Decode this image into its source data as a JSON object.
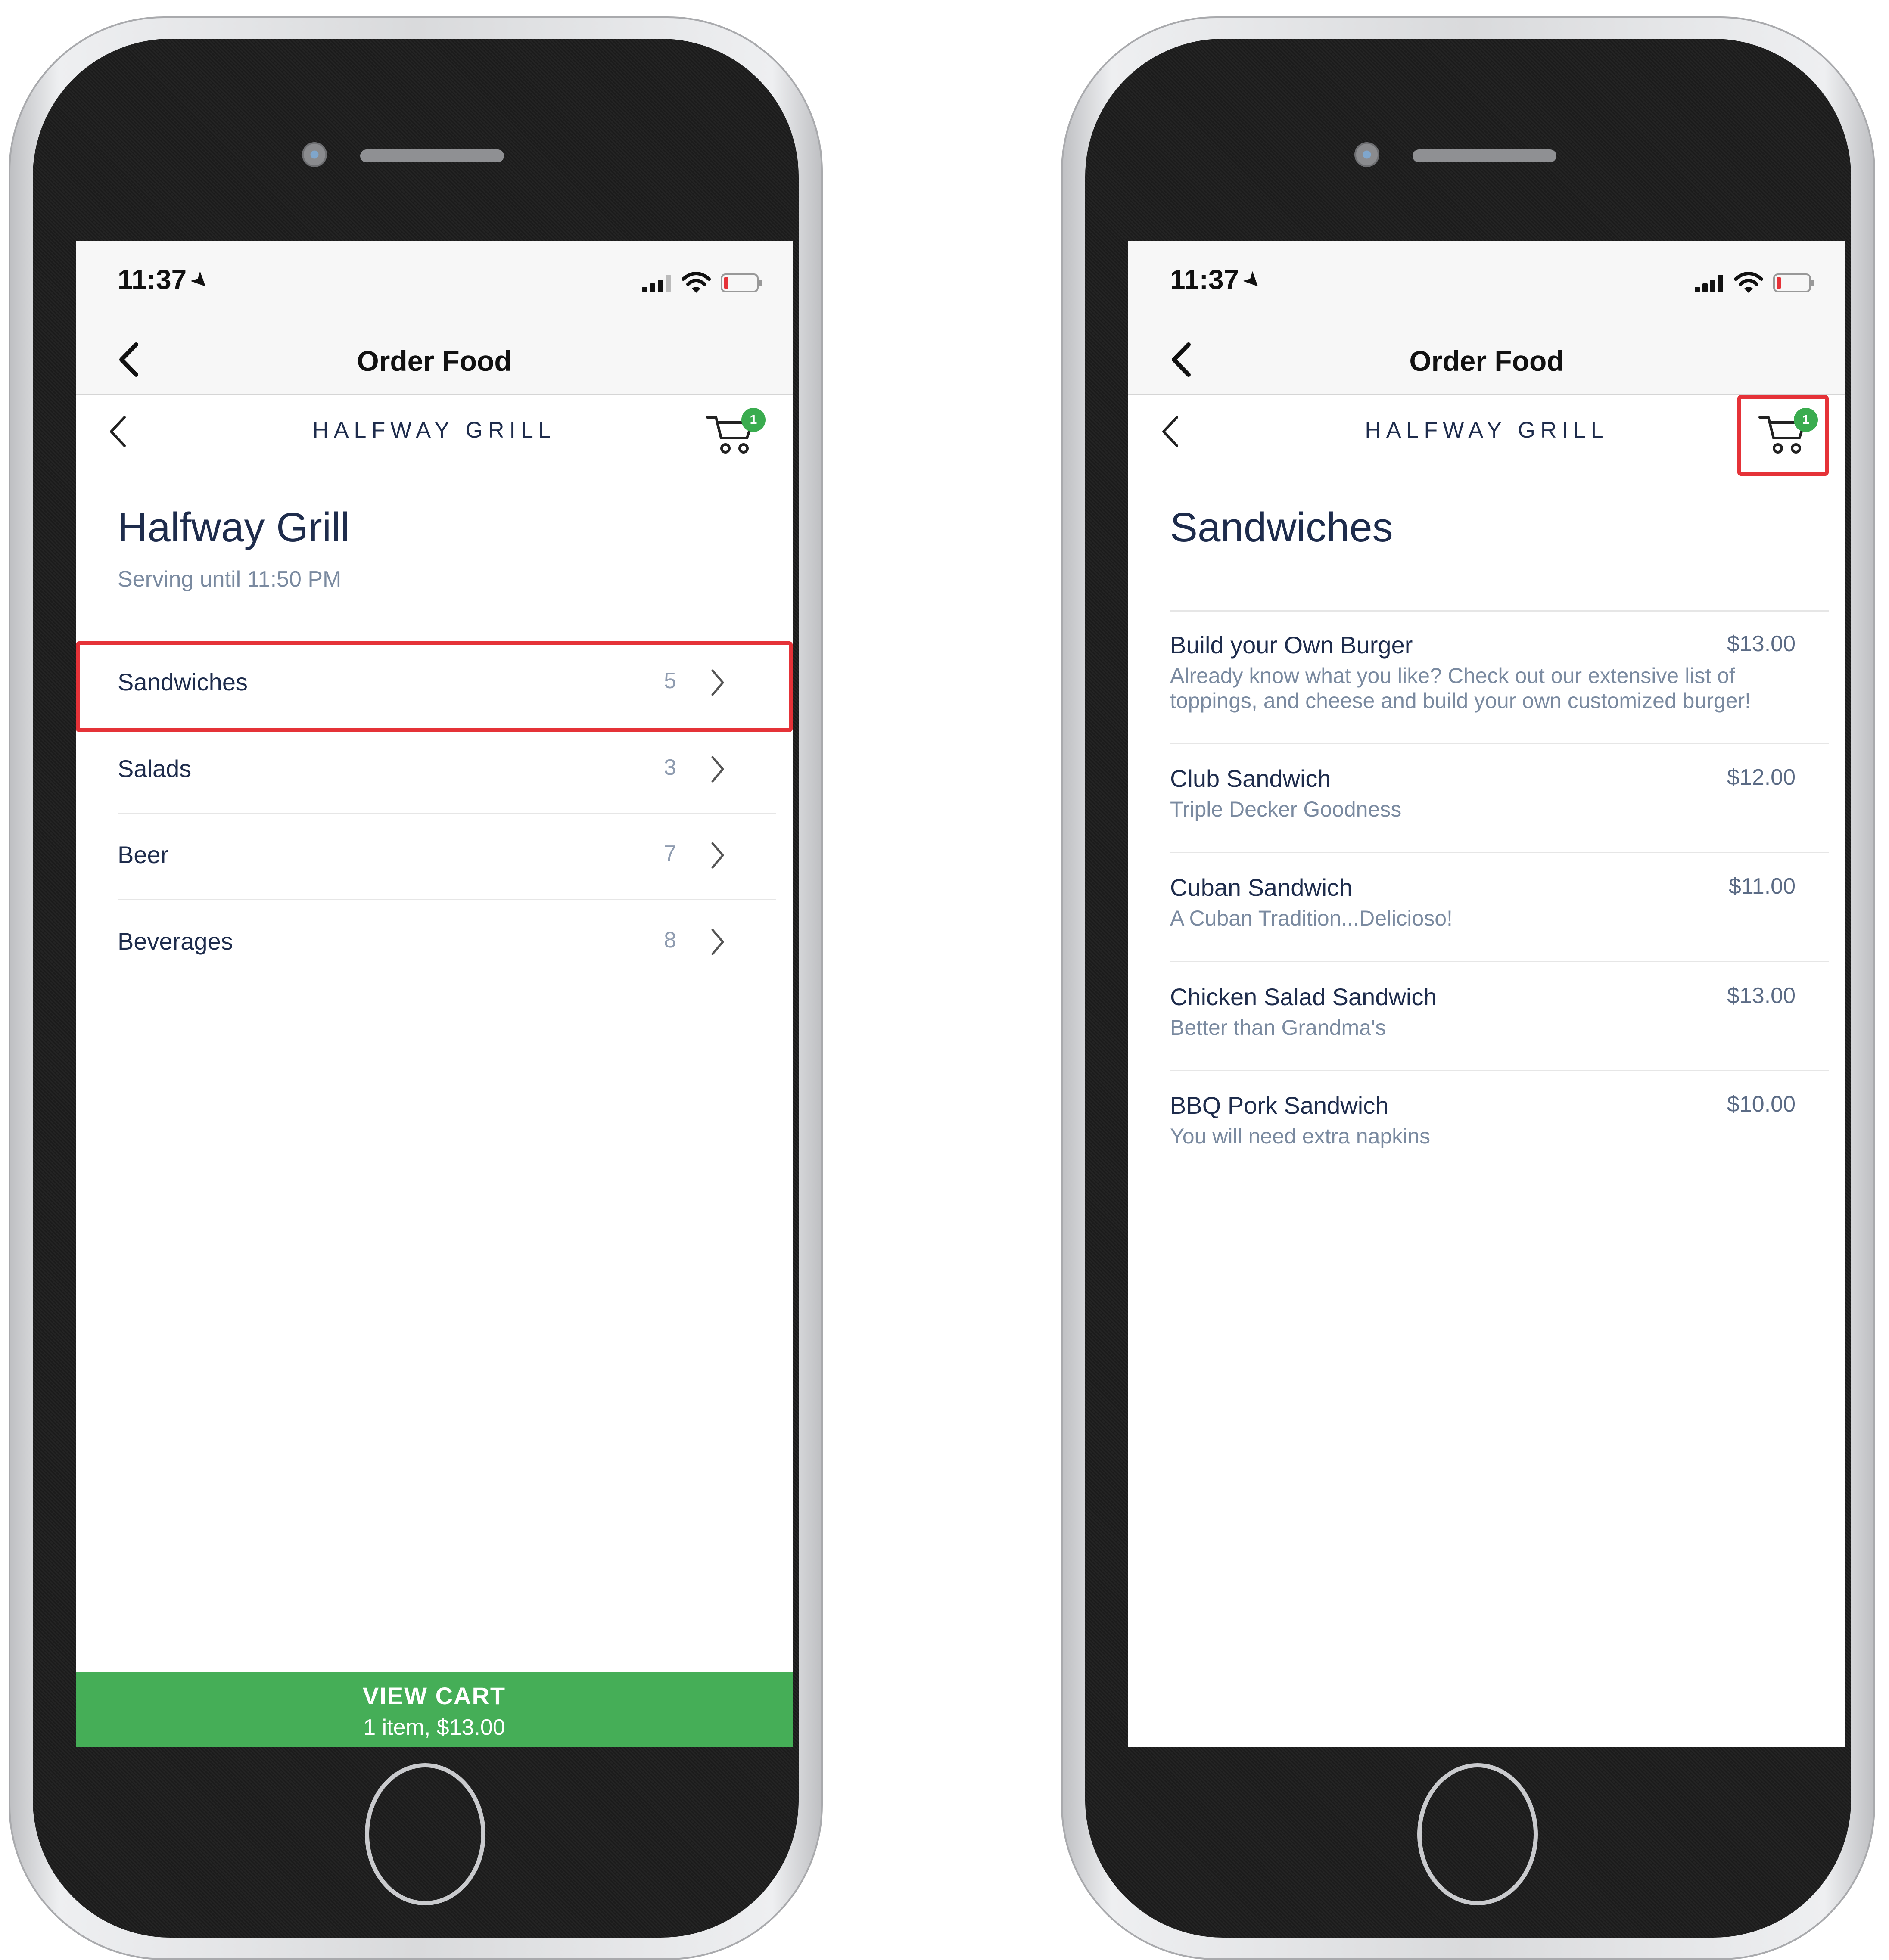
{
  "colors": {
    "accent_green": "#45ae57",
    "badge_green": "#3aac4f",
    "highlight_red": "#e53238",
    "navy_text": "#1e2c4c",
    "muted_text": "#7a8aa0"
  },
  "left_screen": {
    "status_time": "11:37",
    "nav_title": "Order Food",
    "brand": "HALFWAY GRILL",
    "cart_badge": "1",
    "venue_name": "Halfway Grill",
    "venue_hours": "Serving until 11:50 PM",
    "categories": [
      {
        "label": "Sandwiches",
        "count": "5",
        "highlighted": true
      },
      {
        "label": "Salads",
        "count": "3",
        "highlighted": false
      },
      {
        "label": "Beer",
        "count": "7",
        "highlighted": false
      },
      {
        "label": "Beverages",
        "count": "8",
        "highlighted": false
      }
    ],
    "view_cart": {
      "title": "VIEW CART",
      "summary": "1 item, $13.00"
    }
  },
  "right_screen": {
    "status_time": "11:37",
    "nav_title": "Order Food",
    "brand": "HALFWAY GRILL",
    "cart_badge": "1",
    "cart_highlighted": true,
    "section_title": "Sandwiches",
    "items": [
      {
        "name": "Build your Own Burger",
        "price": "$13.00",
        "description": "Already know what you like? Check out our extensive list of toppings, and cheese and build your own customized burger!"
      },
      {
        "name": "Club Sandwich",
        "price": "$12.00",
        "description": "Triple Decker Goodness"
      },
      {
        "name": "Cuban Sandwich",
        "price": "$11.00",
        "description": "A Cuban Tradition...Delicioso!"
      },
      {
        "name": "Chicken Salad Sandwich",
        "price": "$13.00",
        "description": "Better than Grandma's"
      },
      {
        "name": "BBQ Pork Sandwich",
        "price": "$10.00",
        "description": "You will need extra napkins"
      }
    ]
  }
}
